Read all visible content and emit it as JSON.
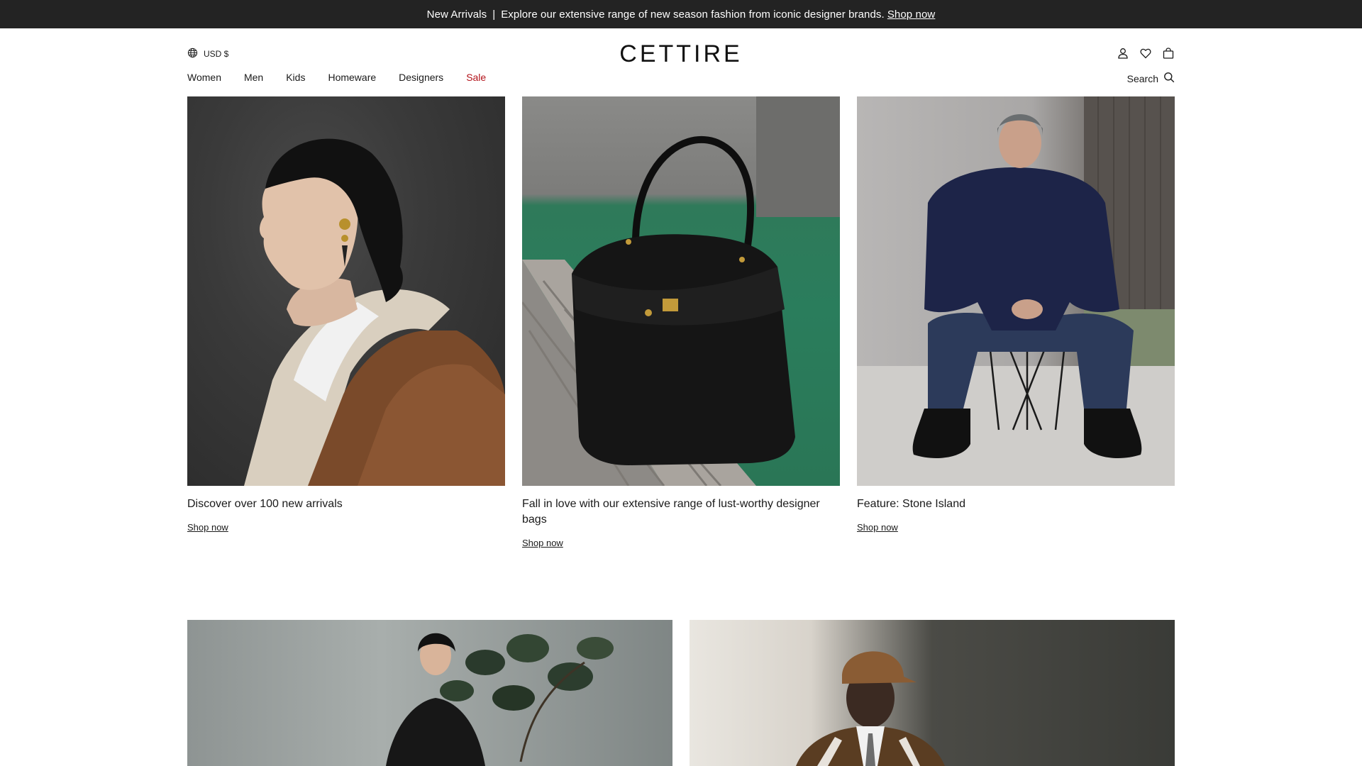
{
  "announcement": {
    "prefix": "New Arrivals",
    "separator": "|",
    "text": "Explore our extensive range of new season fashion from iconic designer brands.",
    "link": "Shop now"
  },
  "header": {
    "currency": "USD $",
    "logo": "CETTIRE",
    "icons": [
      "account-icon",
      "wishlist-heart-icon",
      "bag-icon"
    ]
  },
  "nav": {
    "items": [
      {
        "label": "Women"
      },
      {
        "label": "Men"
      },
      {
        "label": "Kids"
      },
      {
        "label": "Homeware"
      },
      {
        "label": "Designers"
      },
      {
        "label": "Sale"
      }
    ],
    "search_label": "Search",
    "sale_color": "#b3121a"
  },
  "features": [
    {
      "caption": "Discover over 100 new arrivals",
      "link": "Shop now"
    },
    {
      "caption": "Fall in love with our extensive range of lust-worthy designer bags",
      "link": "Shop now"
    },
    {
      "caption": "Feature: Stone Island",
      "link": "Shop now"
    }
  ],
  "colors": {
    "announcement_bg": "#232323",
    "text": "#1a1a1a",
    "background": "#ffffff"
  }
}
